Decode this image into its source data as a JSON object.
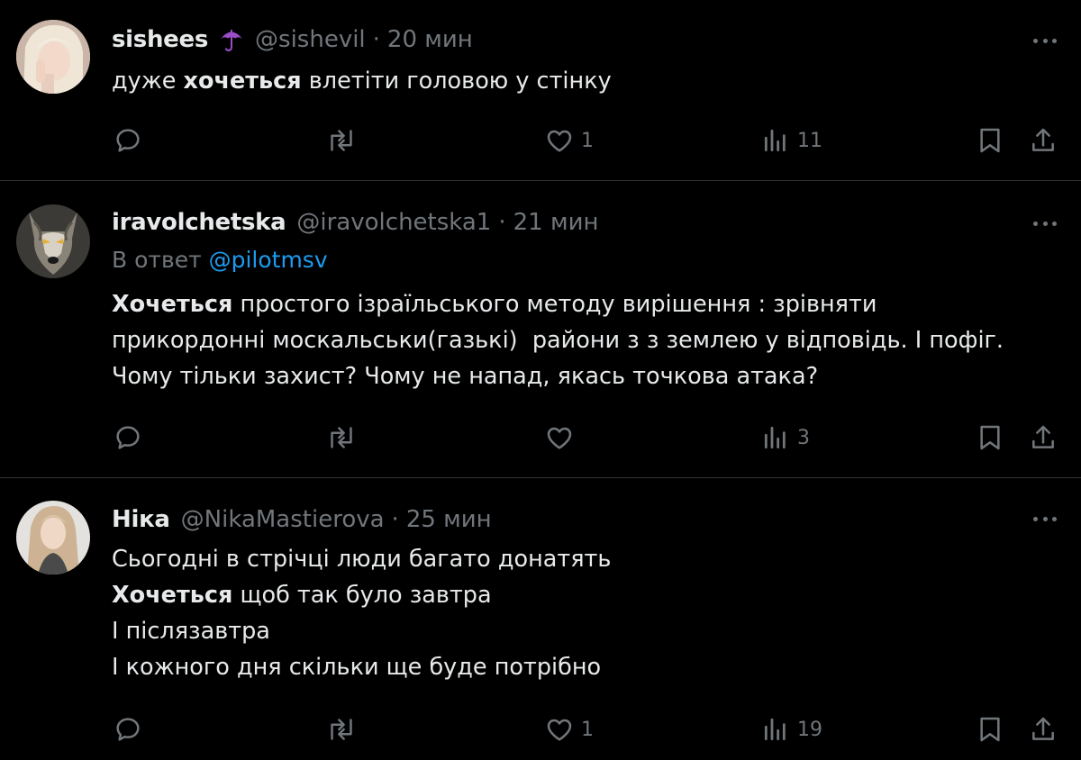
{
  "tweets": [
    {
      "name": "sishees",
      "badge_icon": "umbrella-icon",
      "handle": "@sishevil",
      "separator": "·",
      "time": "20 мин",
      "lines": [
        {
          "parts": [
            {
              "t": "дуже ",
              "b": false
            },
            {
              "t": "хочеться",
              "b": true
            },
            {
              "t": " влетіти головою у стінку",
              "b": false
            }
          ]
        }
      ],
      "likes": "1",
      "views": "11"
    },
    {
      "name": "iravolchetska",
      "handle": "@iravolchetska1",
      "separator": "·",
      "time": "21 мин",
      "reply_prefix": "В ответ ",
      "reply_mention": "@pilotmsv",
      "lines": [
        {
          "parts": [
            {
              "t": "Хочеться",
              "b": true
            },
            {
              "t": " простого ізраїльського методу вирішення : зрівняти",
              "b": false
            }
          ]
        },
        {
          "parts": [
            {
              "t": "прикордонні москальськи(газькі)  райони з з землею у відповідь. І пофіг.",
              "b": false
            }
          ]
        },
        {
          "parts": [
            {
              "t": "Чому тільки захист? Чому не напад, якась точкова атака?",
              "b": false
            }
          ]
        }
      ],
      "likes": "",
      "views": "3"
    },
    {
      "name": "Ніка",
      "handle": "@NikaMastierova",
      "separator": "·",
      "time": "25 мин",
      "lines": [
        {
          "parts": [
            {
              "t": "Сьогодні в стрічці люди багато донатять",
              "b": false
            }
          ]
        },
        {
          "parts": [
            {
              "t": "Хочеться",
              "b": true
            },
            {
              "t": " щоб так було завтра",
              "b": false
            }
          ]
        },
        {
          "parts": [
            {
              "t": "І післязавтра",
              "b": false
            }
          ]
        },
        {
          "parts": [
            {
              "t": "І кожного дня скільки ще буде потрібно",
              "b": false
            }
          ]
        }
      ],
      "likes": "1",
      "views": "19"
    }
  ],
  "icons": {
    "reply": "reply-icon",
    "repost": "repost-icon",
    "like": "heart-icon",
    "views": "views-icon",
    "bookmark": "bookmark-icon",
    "share": "share-icon",
    "more": "more-icon"
  },
  "colors": {
    "background": "#000000",
    "text": "#e7e9ea",
    "muted": "#71767b",
    "link": "#1d9bf0",
    "divider": "#2f3336",
    "badge": "#9b4dca"
  }
}
